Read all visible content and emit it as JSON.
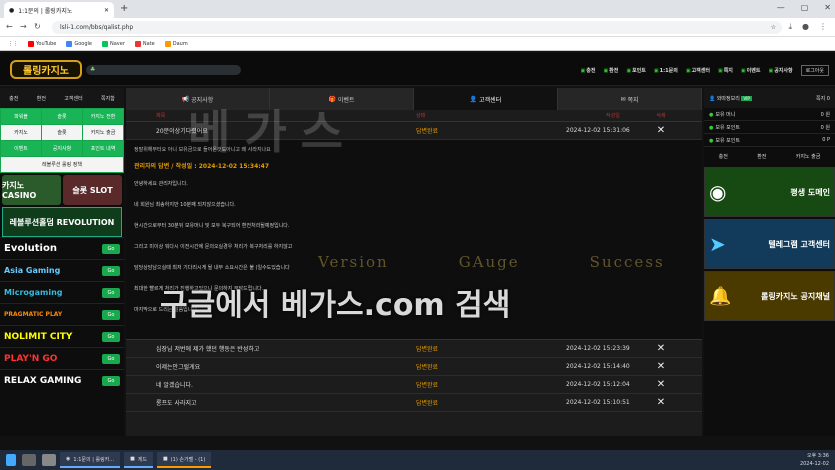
{
  "browser": {
    "tab_title": "1:1문의 | 롤링카지노",
    "url": "lsli-1.com/bbs/qalist.php",
    "bookmarks": [
      "YouTube",
      "Google",
      "Naver",
      "Nate",
      "Daum"
    ]
  },
  "header": {
    "logo": "롤링카지노",
    "menu": [
      "충전",
      "환전",
      "포인트",
      "1:1문의",
      "고객센터",
      "쪽지",
      "이벤트",
      "공지사항"
    ],
    "logout": "로그아웃"
  },
  "left": {
    "account": [
      "충전",
      "환전",
      "고객센터",
      "쪽지함"
    ],
    "grid": [
      "파워볼",
      "슬롯",
      "카지노 전환",
      "카지노",
      "슬롯",
      "카지노 출금",
      "이벤트",
      "공지사항",
      "포인트 내역",
      "레볼루션 롤링 정책"
    ],
    "promos": [
      "카지노 CASINO",
      "슬롯 SLOT"
    ],
    "revolution": "레볼루션홀덤 REVOLUTION",
    "providers": [
      "Evolution",
      "Asia Gaming",
      "Microgaming",
      "PRAGMATIC PLAY",
      "NOLIMIT CITY",
      "PLAY'N GO",
      "RELAX GAMING"
    ],
    "go_label": "Go"
  },
  "main": {
    "tabs": [
      "공지사항",
      "이벤트",
      "고객센터",
      "쪽지"
    ],
    "columns": {
      "title": "제목",
      "status": "상태",
      "date": "작성일",
      "delete": "삭제"
    },
    "first_row": {
      "title": "20분이상기다렸어요",
      "status": "답변완료",
      "date": "2024-12-02 15:31:06"
    },
    "detail": {
      "question": "정말위해부터요 아니 보유금으로 들어온것도아니고 왜 사라지나요",
      "answer_header": "관리자의 답변 / 작성일 : 2024-12-02 15:34:47",
      "paragraphs": [
        "안녕하세요 관리자입니다.",
        "네 회원님 최송하지만 10분째 되지않으셨습니다.",
        "현시간으로부터 30분뒤 보유머니 및 모두 복구되어 환전처리될예정입니다.",
        "그리고 미이상 뭐다시 이전시간에 문의오실경우 처리가 복구처리를 하지않고",
        "담당상담남으실때 최저 기다리시게 될 내부 소요시간은 불 (일수도있습니다",
        "최대한 빨르게 처리가 진행하고있으니 문의하지 부닥드립니다.",
        "마지막으로 드리는 말씀입니다."
      ]
    },
    "rows": [
      {
        "title": "심장님 저번에 제가 했던 행동은 반성하고",
        "status": "답변완료",
        "date": "2024-12-02 15:23:39"
      },
      {
        "title": "이제는안그럴게요",
        "status": "답변완료",
        "date": "2024-12-02 15:14:40"
      },
      {
        "title": "네 알겠습니다.",
        "status": "답변완료",
        "date": "2024-12-02 15:12:04"
      },
      {
        "title": "롱프도 사라지고",
        "status": "답변완료",
        "date": "2024-12-02 15:10:51"
      }
    ],
    "watermark": {
      "big": "베가스",
      "sub": [
        "Version",
        "GAuge",
        "Success"
      ],
      "search": "구글에서 베가스.com 검색"
    }
  },
  "right": {
    "user": "와따정보리",
    "badge": "VIP",
    "notes": "쪽지 0",
    "lines": [
      {
        "label": "보유 머니",
        "value": "0 원"
      },
      {
        "label": "보유 포인트",
        "value": "0 원"
      },
      {
        "label": "보유 포인트",
        "value": "0 P"
      }
    ],
    "buttons": [
      "충전",
      "환전",
      "카지노 출금"
    ],
    "ads": [
      "평생 도메인",
      "텔레그램 고객센터",
      "롤링카지노 공지채널"
    ]
  },
  "taskbar": {
    "apps": [
      "1:1문의 | 롤링카...",
      "게드",
      "(1) 손가벨 - (1)"
    ],
    "time": "오후 3:36",
    "date": "2024-12-02"
  }
}
